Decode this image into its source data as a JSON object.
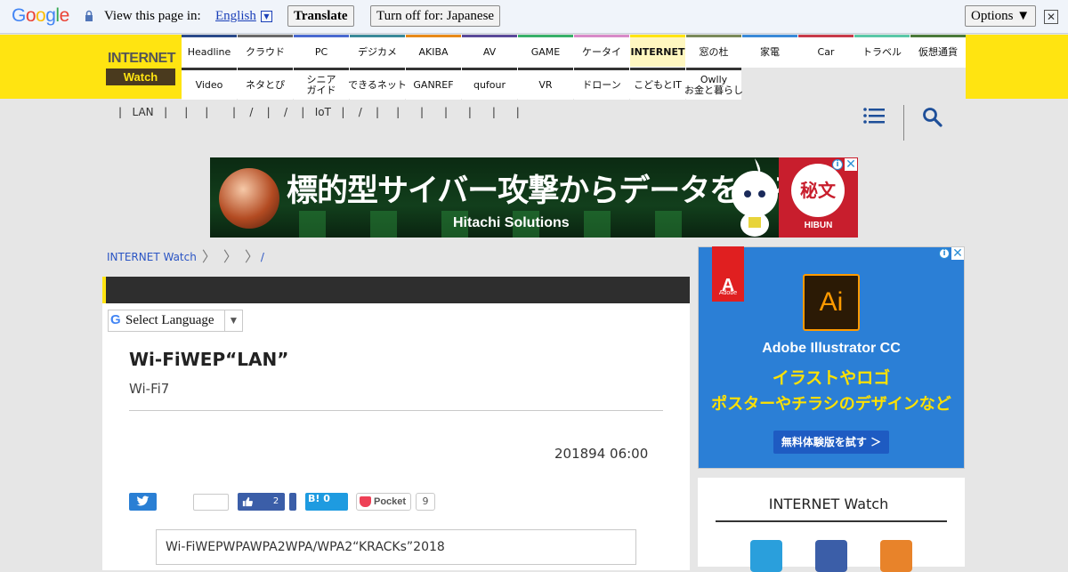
{
  "translate_bar": {
    "logo": "Google",
    "prompt": "View this page in:",
    "language": "English",
    "translate_label": "Translate",
    "turn_off_label": "Turn off for: Japanese",
    "options_label": "Options ▼",
    "close_glyph": "✕"
  },
  "header": {
    "logo_top": "INTERNET",
    "logo_bottom": "Watch",
    "nav_row1": [
      "Headline",
      "クラウド",
      "PC",
      "デジカメ",
      "AKIBA",
      "AV",
      "GAME",
      "ケータイ",
      "INTERNET",
      "窓の杜",
      "家電",
      "Car",
      "トラベル",
      "仮想通貨"
    ],
    "nav_row1_colors": [
      "#2a4a8a",
      "#6a6a6a",
      "#4a6ad0",
      "#3a8a9a",
      "#e88a1a",
      "#5a4a9a",
      "#38b06a",
      "#d88ac8",
      "#ffe411",
      "#7a8a5a",
      "#3a8ad8",
      "#c83a4a",
      "#5ac8a8",
      "#4a7a3a"
    ],
    "nav_row2": [
      "Video",
      "ネタとぴ",
      "シニア\nガイド",
      "できるネット",
      "GANREF",
      "qufour",
      "VR",
      "ドローン",
      "こどもとIT",
      "Owlly\nお金と暮らし"
    ],
    "active_index": 8
  },
  "subnav": {
    "text": "|   LAN   |     |     |       |    /    |    /    |   IoT   |    /    |     |      |      |      |      |      |"
  },
  "banner_ad": {
    "headline": "標的型サイバー攻撃からデータを守る",
    "sub": "Hitachi Solutions",
    "badge_char": "秘文",
    "badge_label": "HIBUN",
    "adchoice": "i",
    "close": "✕"
  },
  "breadcrumb": {
    "items": [
      "INTERNET Watch",
      "",
      "",
      "/"
    ]
  },
  "article": {
    "select_language": "Select Language",
    "select_g": "G",
    "select_arrow": "▼",
    "title": "Wi-FiWEP“LAN”",
    "subtitle": "Wi-Fi7",
    "date": "201894 06:00",
    "fb_count": "2",
    "hatena_label": "B! 0",
    "pocket_label": "Pocket",
    "pocket_count": "9",
    "summary": "Wi-FiWEPWPAWPA2WPA/WPA2“KRACKs”2018"
  },
  "side_ad": {
    "brand": "Adobe",
    "brand_glyph": "A",
    "product_icon": "Ai",
    "product": "Adobe Illustrator CC",
    "line1": "イラストやロゴ",
    "line2": "ポスターやチラシのデザインなど",
    "cta": "無料体験版を試す ＞",
    "adchoice": "i",
    "close": "✕"
  },
  "follow": {
    "title": "INTERNET Watch"
  }
}
